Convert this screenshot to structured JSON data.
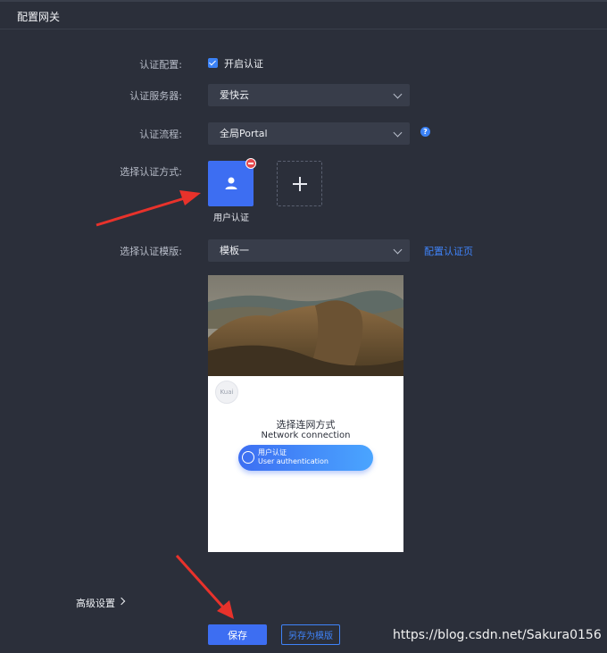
{
  "header": {
    "title": "配置网关"
  },
  "form": {
    "auth_config": {
      "label": "认证配置:",
      "checkbox_label": "开启认证",
      "checked": true
    },
    "auth_server": {
      "label": "认证服务器:",
      "value": "爱快云"
    },
    "auth_flow": {
      "label": "认证流程:",
      "value": "全局Portal"
    },
    "auth_method": {
      "label": "选择认证方式:",
      "card_label": "用户认证"
    },
    "auth_template": {
      "label": "选择认证模版:",
      "value": "模板一",
      "link": "配置认证页"
    }
  },
  "preview": {
    "logo_text": "Kuai",
    "title_cn": "选择连网方式",
    "title_en": "Network connection",
    "button_cn": "用户认证",
    "button_en": "User authentication"
  },
  "advanced": {
    "label": "高级设置"
  },
  "actions": {
    "save": "保存",
    "save_as_template": "另存为模版"
  },
  "watermark": "https://blog.csdn.net/Sakura0156",
  "colors": {
    "accent": "#3d6ef2",
    "background": "#2b2f3a",
    "field": "#383d4a",
    "annotation_arrow": "#e8322b"
  },
  "icons": [
    "checkbox-checked-icon",
    "chevron-down-icon",
    "help-icon",
    "user-icon",
    "remove-icon",
    "plus-icon",
    "chevron-right-icon"
  ]
}
